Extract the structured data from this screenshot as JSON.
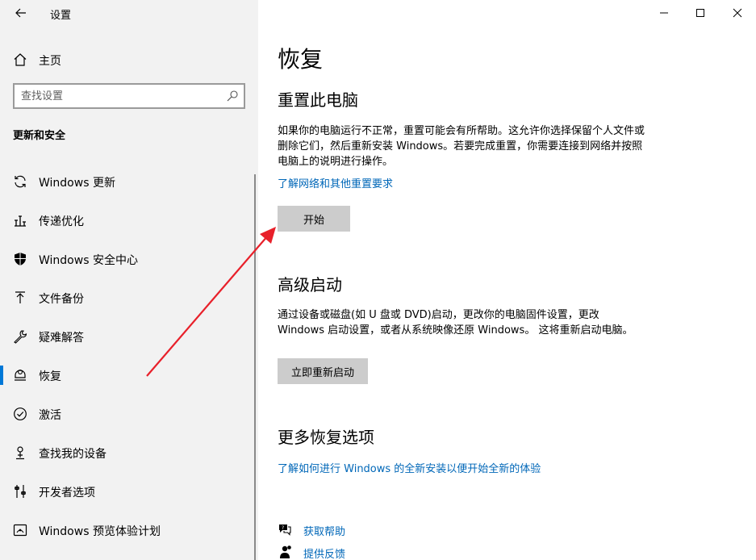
{
  "app": {
    "title": "设置"
  },
  "sidebar": {
    "home_label": "主页",
    "search_placeholder": "查找设置",
    "section_title": "更新和安全",
    "items": [
      {
        "label": "Windows 更新",
        "icon": "sync-icon"
      },
      {
        "label": "传递优化",
        "icon": "delivery-optimization-icon"
      },
      {
        "label": "Windows 安全中心",
        "icon": "shield-icon"
      },
      {
        "label": "文件备份",
        "icon": "backup-icon"
      },
      {
        "label": "疑难解答",
        "icon": "wrench-icon"
      },
      {
        "label": "恢复",
        "icon": "recovery-icon",
        "active": true
      },
      {
        "label": "激活",
        "icon": "check-circle-icon"
      },
      {
        "label": "查找我的设备",
        "icon": "find-device-icon"
      },
      {
        "label": "开发者选项",
        "icon": "developer-icon"
      },
      {
        "label": "Windows 预览体验计划",
        "icon": "insider-icon"
      }
    ]
  },
  "main": {
    "title": "恢复",
    "reset": {
      "heading": "重置此电脑",
      "description": "如果你的电脑运行不正常，重置可能会有所帮助。这允许你选择保留个人文件或删除它们，然后重新安装 Windows。若要完成重置，你需要连接到网络并按照电脑上的说明进行操作。",
      "link": "了解网络和其他重置要求",
      "button": "开始"
    },
    "advanced": {
      "heading": "高级启动",
      "description": "通过设备或磁盘(如 U 盘或 DVD)启动，更改你的电脑固件设置，更改 Windows 启动设置，或者从系统映像还原 Windows。 这将重新启动电脑。",
      "button": "立即重新启动"
    },
    "more": {
      "heading": "更多恢复选项",
      "link": "了解如何进行 Windows 的全新安装以便开始全新的体验"
    },
    "help": {
      "get_help": "获取帮助",
      "feedback": "提供反馈"
    }
  },
  "colors": {
    "accent": "#0078d7",
    "link": "#0067b8",
    "annotation_arrow": "#e8202a"
  }
}
